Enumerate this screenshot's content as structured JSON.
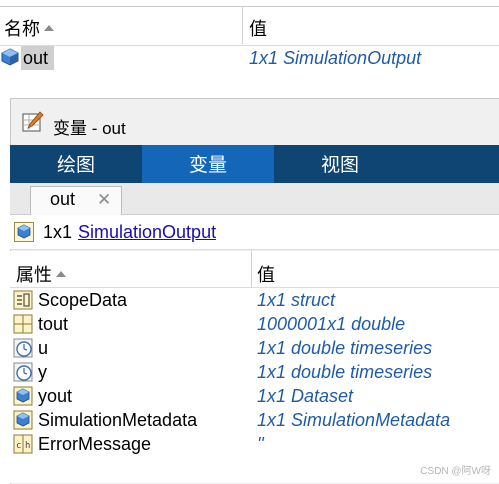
{
  "workspace": {
    "col_name": "名称",
    "col_value": "值",
    "rows": [
      {
        "name": "out",
        "value": "1x1 SimulationOutput",
        "icon": "struct-cube-icon"
      }
    ]
  },
  "editor": {
    "window_title": "变量 - out",
    "tabs": [
      {
        "label": "绘图",
        "active": false
      },
      {
        "label": "变量",
        "active": true
      },
      {
        "label": "视图",
        "active": false
      }
    ],
    "doc_tab": {
      "label": "out",
      "close": "✕"
    },
    "summary": {
      "size": "1x1",
      "class_link": "SimulationOutput"
    },
    "col_name": "属性",
    "col_value": "值",
    "properties": [
      {
        "name": "ScopeData",
        "value": "1x1 struct",
        "icon": "struct-icon"
      },
      {
        "name": "tout",
        "value": "1000001x1 double",
        "icon": "matrix-icon"
      },
      {
        "name": "u",
        "value": "1x1 double timeseries",
        "icon": "timeseries-icon"
      },
      {
        "name": "y",
        "value": "1x1 double timeseries",
        "icon": "timeseries-icon"
      },
      {
        "name": "yout",
        "value": "1x1 Dataset",
        "icon": "object-cube-icon"
      },
      {
        "name": "SimulationMetadata",
        "value": "1x1 SimulationMetadata",
        "icon": "object-cube-icon"
      },
      {
        "name": "ErrorMessage",
        "value": "''",
        "icon": "char-array-icon"
      }
    ]
  },
  "watermark": "CSDN @阿W呀",
  "colors": {
    "tab_bar": "#0e4573",
    "tab_active": "#1466b8",
    "value_text": "#1f5ba8",
    "link": "#1a0dab"
  }
}
